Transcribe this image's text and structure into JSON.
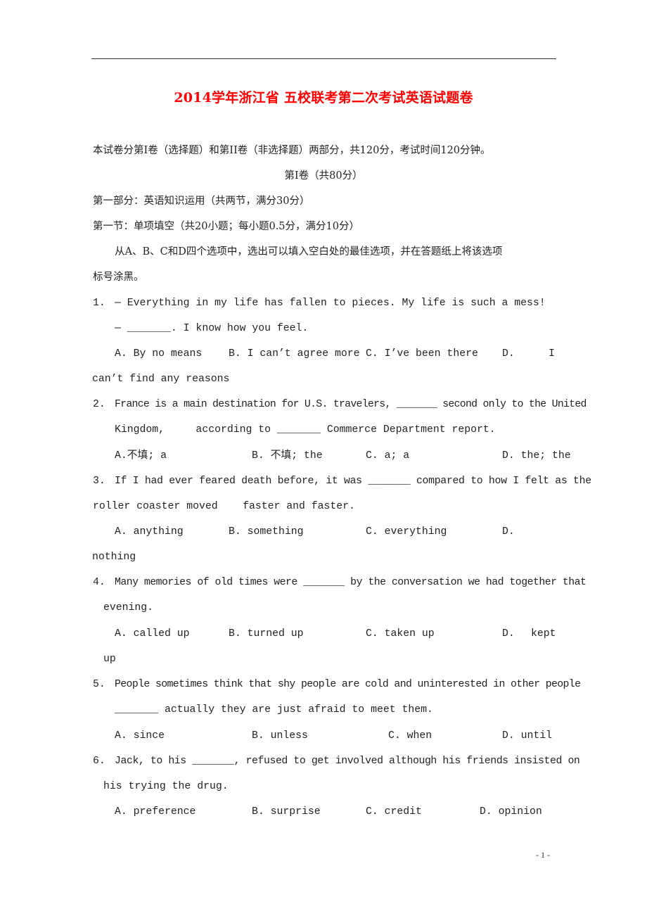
{
  "document": {
    "title": "2014学年浙江省 五校联考第二次考试英语试题卷",
    "title_color": "#ff0000",
    "intro": "本试卷分第Ⅰ卷（选择题）和第II卷（非选择题）两部分，共120分，考试时间120分钟。",
    "volume_heading": "第Ⅰ卷（共80分）",
    "part_heading": "第一部分：英语知识运用（共两节，满分30分）",
    "section_heading": "第一节：单项填空（共20小题；每小题0.5分，满分10分）",
    "instruction_line1": "从A、B、C和D四个选项中，选出可以填入空白处的最佳选项，并在答题纸上将该选项",
    "instruction_line2": "标号涂黑。",
    "page_number": "- 1 -"
  },
  "questions": [
    {
      "number": "1.",
      "lines": [
        "— Everything in my life has fallen to pieces. My life is such a mess!",
        "— _______. I know how you feel."
      ],
      "options": [
        "A. By no means",
        "B. I can’t agree more",
        "C. I’ve been there",
        "D.",
        "I",
        "can’t find any reasons"
      ]
    },
    {
      "number": "2.",
      "lines": [
        "France is a main destination for U.S. travelers, _______ second only to the United",
        "Kingdom,     according to _______ Commerce Department report."
      ],
      "options": [
        "A.不填; a",
        "B. 不填; the",
        "C. a; a",
        "D. the; the"
      ]
    },
    {
      "number": "3.",
      "lines": [
        "If I had ever feared death before, it was _______ compared to how I felt as the",
        "roller coaster moved    faster and faster."
      ],
      "options": [
        "A. anything",
        "B. something",
        "C. everything",
        "D.",
        "nothing"
      ]
    },
    {
      "number": "4.",
      "lines": [
        "Many memories of old times were _______ by the conversation we had together that",
        "evening."
      ],
      "options": [
        "A. called up",
        "B. turned up",
        "C. taken up",
        "D.",
        "kept",
        "up"
      ]
    },
    {
      "number": "5.",
      "lines": [
        "People sometimes think that shy people are cold and uninterested in other people",
        "_______ actually they are just afraid to meet them."
      ],
      "options": [
        "A. since",
        "B. unless",
        "C. when",
        "D. until"
      ]
    },
    {
      "number": "6.",
      "lines": [
        "Jack, to his _______, refused to get involved although his friends insisted on",
        "his trying the drug."
      ],
      "options": [
        "A. preference",
        "B. surprise",
        "C. credit",
        "D. opinion"
      ]
    }
  ]
}
